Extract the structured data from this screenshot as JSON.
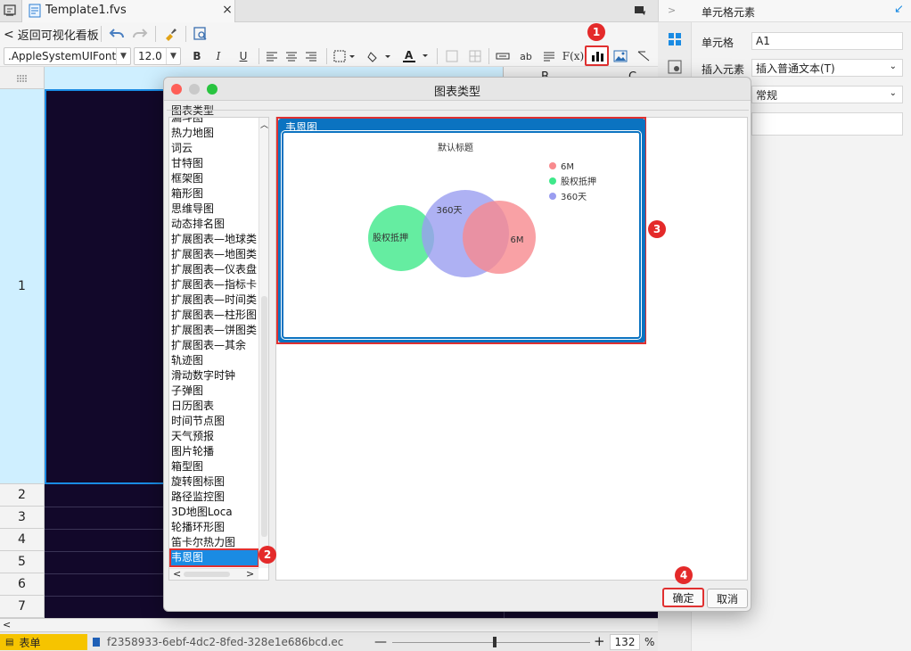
{
  "tabs": {
    "file_title": "Template1.fvs"
  },
  "toolbar": {
    "back_label": "返回可视化看板",
    "font_name": ".AppleSystemUIFont",
    "font_size": "12.0",
    "ab_label": "ab",
    "fx_label": "F(x)"
  },
  "column_header": {
    "col_b": "B",
    "col_c": "C"
  },
  "rows": [
    "1",
    "2",
    "3",
    "4",
    "5",
    "6",
    "7"
  ],
  "right_panel": {
    "title": "单元格元素",
    "cell_label": "单元格",
    "cell_value": "A1",
    "insert_label": "插入元素",
    "insert_value": "插入普通文本(T)",
    "style_value": "常规"
  },
  "dialog": {
    "title": "图表类型",
    "group_label": "图表类型",
    "chart_types": [
      "漏斗图",
      "热力地图",
      "词云",
      "甘特图",
      "框架图",
      "箱形图",
      "思维导图",
      "动态排名图",
      "扩展图表—地球类",
      "扩展图表—地图类",
      "扩展图表—仪表盘",
      "扩展图表—指标卡",
      "扩展图表—时间类",
      "扩展图表—柱形图",
      "扩展图表—饼图类",
      "扩展图表—其余",
      "轨迹图",
      "滑动数字时钟",
      "子弹图",
      "日历图表",
      "时间节点图",
      "天气预报",
      "图片轮播",
      "箱型图",
      "旋转图标图",
      "路径监控图",
      "3D地图Loca",
      "轮播环形图",
      "笛卡尔热力图",
      "韦恩图"
    ],
    "preview_card_title": "韦恩图",
    "ok_label": "确定",
    "cancel_label": "取消"
  },
  "chart_data": {
    "type": "venn",
    "title": "默认标题",
    "legend_position": "top-right",
    "series": [
      {
        "name": "6M",
        "color": "#f88a8e"
      },
      {
        "name": "股权抵押",
        "color": "#3fe88a"
      },
      {
        "name": "360天",
        "color": "#9a9df0"
      }
    ],
    "labels": [
      "股权抵押",
      "360天",
      "6M"
    ]
  },
  "badges": [
    "1",
    "2",
    "3",
    "4"
  ],
  "status": {
    "sheet_tab": "表单",
    "file_hash": "f2358933-6ebf-4dc2-8fed-328e1e686bcd.ec",
    "zoom": "132",
    "percent": "%"
  },
  "colors": {
    "accent": "#1a8be3",
    "badge": "#e42a2a",
    "card_blue": "#0b73c1",
    "sheet_bg": "#12082a"
  }
}
